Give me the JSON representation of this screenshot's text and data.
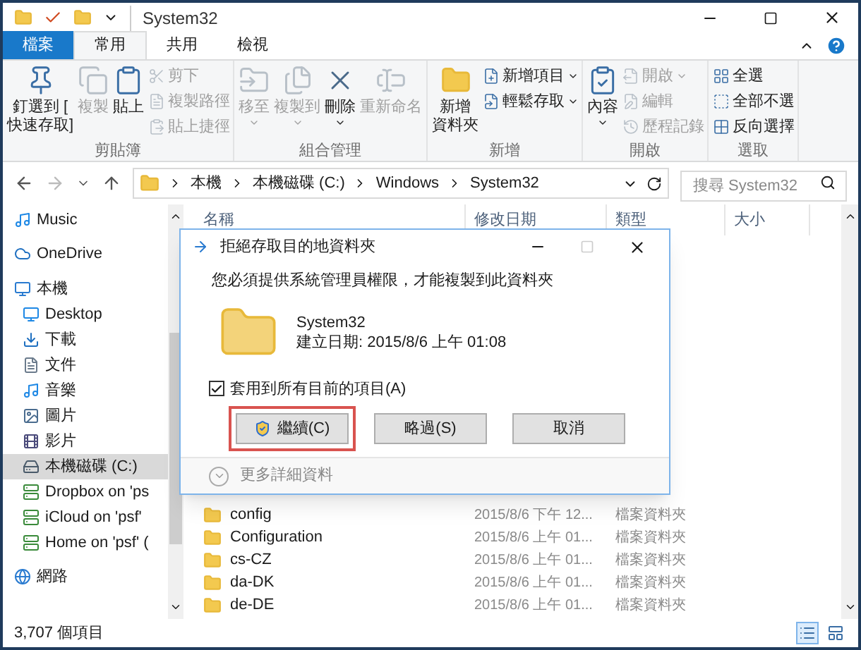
{
  "window": {
    "title": "System32"
  },
  "tabs": [
    {
      "label": "檔案",
      "kind": "file",
      "selected": false
    },
    {
      "label": "常用",
      "kind": "tab",
      "selected": true
    },
    {
      "label": "共用",
      "kind": "tab",
      "selected": false
    },
    {
      "label": "檢視",
      "kind": "tab",
      "selected": false
    }
  ],
  "ribbon": {
    "groups": [
      {
        "label": "剪貼簿",
        "items": [
          {
            "kind": "large",
            "lines": [
              "釘選到 [",
              "快速存取]"
            ],
            "disabled": false,
            "dropdown": false
          },
          {
            "kind": "large",
            "lines": [
              "複製"
            ],
            "disabled": true,
            "dropdown": false
          },
          {
            "kind": "large",
            "lines": [
              "貼上"
            ],
            "disabled": false,
            "dropdown": false
          },
          {
            "kind": "small",
            "label": "剪下",
            "disabled": true,
            "dropdown": false
          },
          {
            "kind": "small",
            "label": "複製路徑",
            "disabled": true,
            "dropdown": false
          },
          {
            "kind": "small",
            "label": "貼上捷徑",
            "disabled": true,
            "dropdown": false
          }
        ]
      },
      {
        "label": "組合管理",
        "items": [
          {
            "kind": "large",
            "lines": [
              "移至"
            ],
            "disabled": true,
            "dropdown": true
          },
          {
            "kind": "large",
            "lines": [
              "複製到"
            ],
            "disabled": true,
            "dropdown": true
          },
          {
            "kind": "large",
            "lines": [
              "刪除"
            ],
            "disabled": false,
            "dropdown": true
          },
          {
            "kind": "large",
            "lines": [
              "重新命名"
            ],
            "disabled": true,
            "dropdown": false
          }
        ]
      },
      {
        "label": "新增",
        "items": [
          {
            "kind": "large",
            "lines": [
              "新增",
              "資料夾"
            ],
            "disabled": false,
            "dropdown": false
          },
          {
            "kind": "small",
            "label": "新增項目",
            "disabled": false,
            "dropdown": true
          },
          {
            "kind": "small",
            "label": "輕鬆存取",
            "disabled": false,
            "dropdown": true
          }
        ]
      },
      {
        "label": "開啟",
        "items": [
          {
            "kind": "large",
            "lines": [
              "內容"
            ],
            "disabled": false,
            "dropdown": true
          },
          {
            "kind": "small",
            "label": "開啟",
            "disabled": true,
            "dropdown": true
          },
          {
            "kind": "small",
            "label": "編輯",
            "disabled": true,
            "dropdown": false
          },
          {
            "kind": "small",
            "label": "歷程記錄",
            "disabled": true,
            "dropdown": false
          }
        ]
      },
      {
        "label": "選取",
        "items": [
          {
            "kind": "small",
            "label": "全選",
            "disabled": false,
            "dropdown": false
          },
          {
            "kind": "small",
            "label": "全部不選",
            "disabled": false,
            "dropdown": false
          },
          {
            "kind": "small",
            "label": "反向選擇",
            "disabled": false,
            "dropdown": false
          }
        ]
      }
    ]
  },
  "address": {
    "crumbs": [
      "本機",
      "本機磁碟 (C:)",
      "Windows",
      "System32"
    ],
    "search_placeholder": "搜尋 System32"
  },
  "sidebar": {
    "items": [
      {
        "label": "Music",
        "selected": false
      },
      {
        "label": "OneDrive",
        "selected": false
      },
      {
        "label": "本機",
        "selected": false,
        "children": [
          {
            "label": "Desktop",
            "selected": false
          },
          {
            "label": "下載",
            "selected": false
          },
          {
            "label": "文件",
            "selected": false
          },
          {
            "label": "音樂",
            "selected": false
          },
          {
            "label": "圖片",
            "selected": false
          },
          {
            "label": "影片",
            "selected": false
          },
          {
            "label": "本機磁碟 (C:)",
            "selected": true
          },
          {
            "label": "Dropbox on 'ps",
            "selected": false
          },
          {
            "label": "iCloud on 'psf'",
            "selected": false
          },
          {
            "label": "Home on 'psf' (",
            "selected": false
          }
        ]
      },
      {
        "label": "網路",
        "selected": false
      }
    ]
  },
  "table": {
    "columns": [
      "名稱",
      "修改日期",
      "類型",
      "大小"
    ],
    "rows": [
      {
        "name": "config",
        "modified": "2015/8/6 下午 12...",
        "type": "檔案資料夾"
      },
      {
        "name": "Configuration",
        "modified": "2015/8/6 上午 01...",
        "type": "檔案資料夾"
      },
      {
        "name": "cs-CZ",
        "modified": "2015/8/6 上午 01...",
        "type": "檔案資料夾"
      },
      {
        "name": "da-DK",
        "modified": "2015/8/6 上午 01...",
        "type": "檔案資料夾"
      },
      {
        "name": "de-DE",
        "modified": "2015/8/6 上午 01...",
        "type": "檔案資料夾"
      }
    ]
  },
  "dialog": {
    "title": "拒絕存取目的地資料夾",
    "message": "您必須提供系統管理員權限，才能複製到此資料夾",
    "folder_name": "System32",
    "folder_date": "建立日期: 2015/8/6 上午 01:08",
    "checkbox": {
      "label": "套用到所有目前的項目(A)",
      "checked": true
    },
    "buttons": [
      {
        "label": "繼續(C)",
        "shield": true,
        "highlighted": true
      },
      {
        "label": "略過(S)",
        "shield": false,
        "highlighted": false
      },
      {
        "label": "取消",
        "shield": false,
        "highlighted": false
      }
    ],
    "details": "更多詳細資料"
  },
  "status_bar": {
    "count": "3,707 個項目",
    "views": [
      {
        "kind": "details",
        "selected": true
      },
      {
        "kind": "thumbnails",
        "selected": false
      }
    ]
  }
}
